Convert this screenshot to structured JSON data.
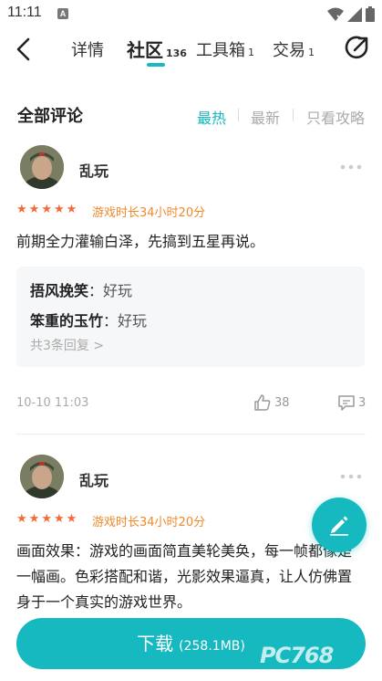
{
  "status": {
    "time": "11:11",
    "notif_letter": "A"
  },
  "nav": {
    "tabs": [
      {
        "label": "详情",
        "count": ""
      },
      {
        "label": "社区",
        "count": "136"
      },
      {
        "label": "工具箱",
        "count": "1"
      },
      {
        "label": "交易",
        "count": "1"
      }
    ],
    "active_tab": "社区"
  },
  "section": {
    "title": "全部评论",
    "sort_options": [
      "最热",
      "最新",
      "只看攻略"
    ],
    "active_sort": "最热"
  },
  "comments": [
    {
      "user": "乱玩",
      "rating": 5,
      "playtime": "游戏时长34小时20分",
      "text": "前期全力灌输白泽，先搞到五星再说。",
      "replies": [
        {
          "name": "捂风挽笑",
          "content": "好玩"
        },
        {
          "name": "笨重的玉竹",
          "content": "好玩"
        }
      ],
      "more_replies": "共3条回复 >",
      "date": "10-10 11:03",
      "likes": "38",
      "reply_count": "3"
    },
    {
      "user": "乱玩",
      "rating": 5,
      "playtime": "游戏时长34小时20分",
      "text_lines": [
        "画面效果：游戏的画面简直美轮美奂，每一帧都像是",
        "一幅画。色彩搭配和谐，光影效果逼真，让人仿佛置",
        "身于一个真实的游戏世界。"
      ]
    }
  ],
  "download": {
    "label": "下载",
    "size": "(258.1MB)"
  },
  "watermark": "PC768",
  "colors": {
    "accent": "#16b9bf",
    "star": "#f26b3a",
    "playtime": "#f0892a"
  }
}
